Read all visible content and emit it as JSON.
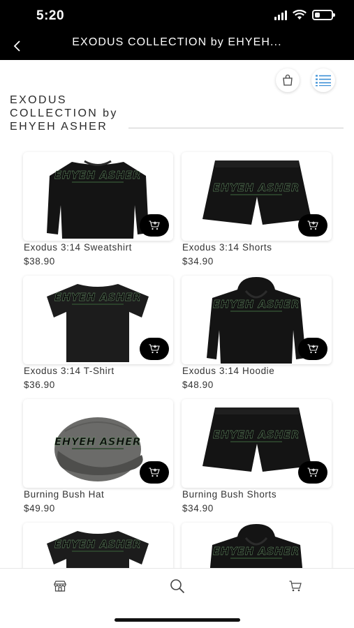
{
  "status_bar": {
    "time": "5:20"
  },
  "nav": {
    "title": "EXODUS COLLECTION by EHYEH..."
  },
  "collection": {
    "heading": "EXODUS COLLECTION by EHYEH ASHER"
  },
  "products": [
    {
      "name": "Exodus 3:14 Sweatshirt",
      "price": "$38.90",
      "image": "sweatshirt"
    },
    {
      "name": "Exodus 3:14 Shorts",
      "price": "$34.90",
      "image": "shorts"
    },
    {
      "name": "Exodus 3:14 T-Shirt",
      "price": "$36.90",
      "image": "tshirt"
    },
    {
      "name": "Exodus 3:14 Hoodie",
      "price": "$48.90",
      "image": "hoodie"
    },
    {
      "name": "Burning Bush Hat",
      "price": "$49.90",
      "image": "hat"
    },
    {
      "name": "Burning Bush Shorts",
      "price": "$34.90",
      "image": "shorts"
    },
    {
      "name": "",
      "price": "",
      "image": "tshirt"
    },
    {
      "name": "",
      "price": "",
      "image": "hoodie"
    }
  ],
  "brand_print": "EHYEH ASHER",
  "icons": {
    "back": "chevron-left-icon",
    "bag": "shopping-bag-icon",
    "list": "list-view-icon",
    "add_to_cart": "add-to-cart-icon",
    "tab_store": "store-icon",
    "tab_search": "search-icon",
    "tab_cart": "cart-icon"
  },
  "colors": {
    "header": "#000000",
    "accent": "#3a8fd6",
    "fab": "#000000"
  }
}
